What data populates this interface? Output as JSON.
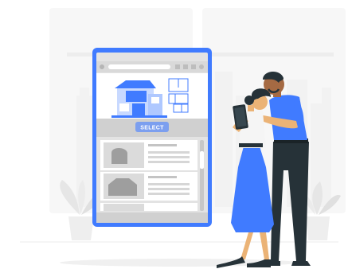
{
  "phone": {
    "select_button_label": "SELECT"
  },
  "palette": {
    "accent": "#407BFF",
    "accent_light": "#C8D9FF",
    "phone_frame": "#407BFF",
    "screen_bg": "#E3E3E3",
    "city_bg": "#F0F0F0",
    "dark": "#263238",
    "skin": "#EBB376",
    "skin_dark": "#A56A43"
  },
  "icons": [
    "home-icon",
    "menu-icon",
    "search-icon",
    "floor-plan-icon",
    "house-icon",
    "tablet-icon"
  ]
}
